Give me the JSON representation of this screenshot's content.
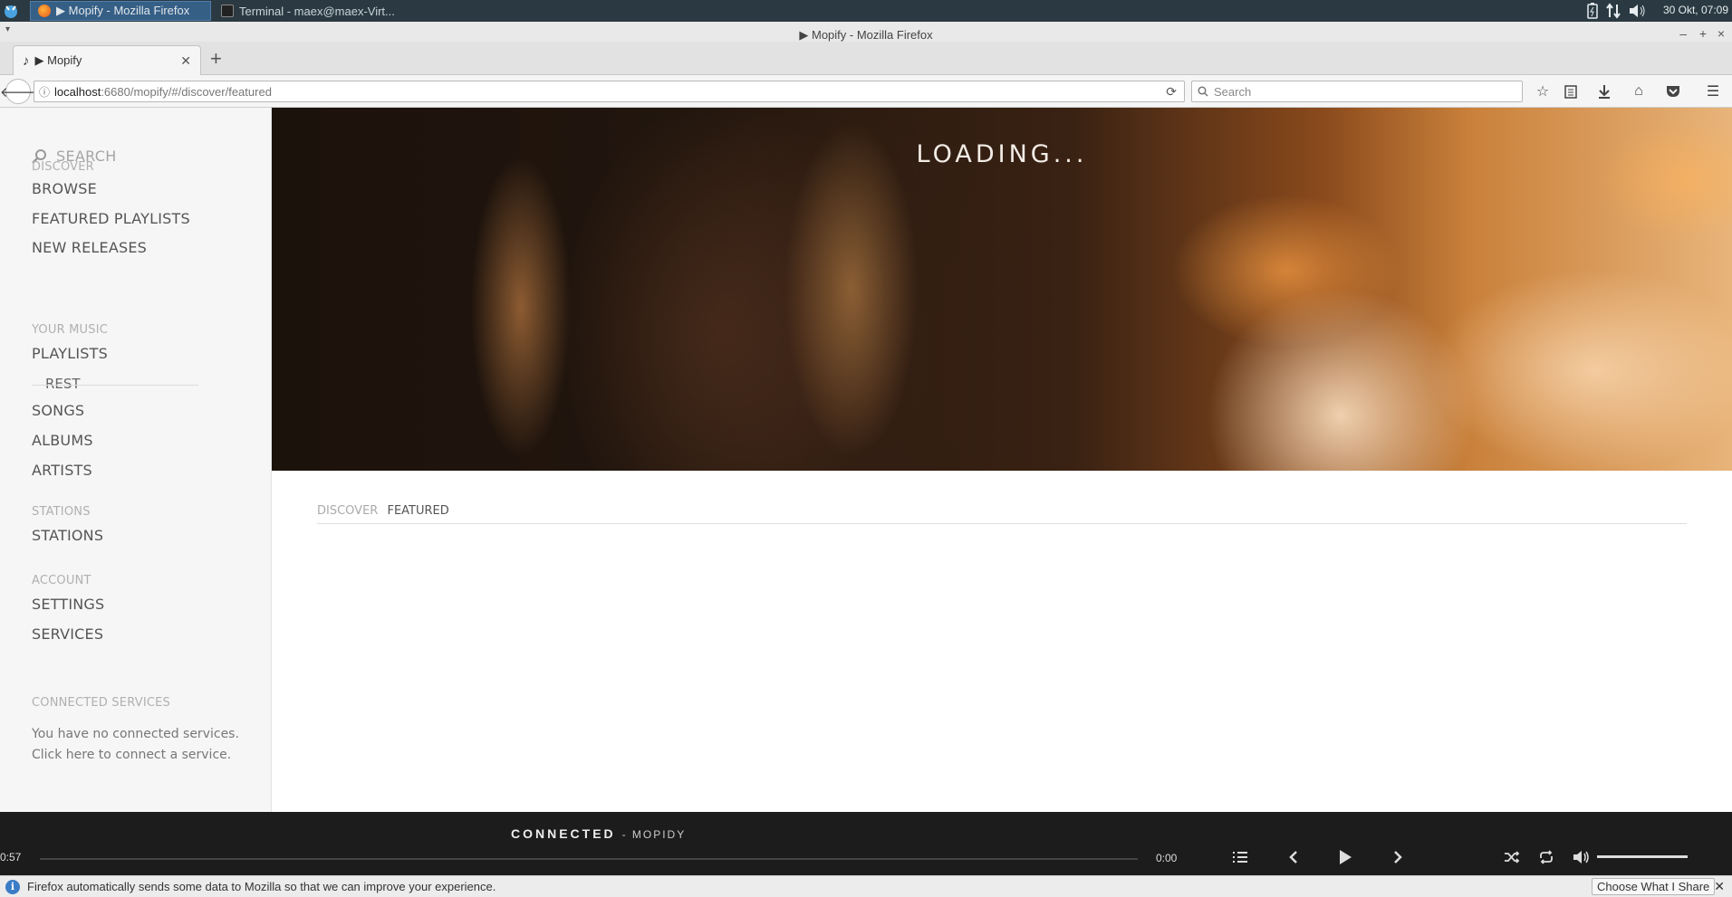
{
  "os": {
    "taskbar": [
      {
        "label": "▶ Mopify - Mozilla Firefox",
        "active": true
      },
      {
        "label": "Terminal - maex@maex-Virt...",
        "active": false
      }
    ],
    "clock": "30 Okt, 07:09"
  },
  "browser": {
    "window_title": "▶ Mopify - Mozilla Firefox",
    "tab_title": "▶ Mopify",
    "url_host": "localhost",
    "url_rest": ":6680/mopify/#/discover/featured",
    "search_placeholder": "Search"
  },
  "sidebar": {
    "search_label": "SEARCH",
    "sections": [
      {
        "title": "DISCOVER",
        "items": [
          "BROWSE",
          "FEATURED PLAYLISTS",
          "NEW RELEASES"
        ]
      },
      {
        "title": "YOUR MUSIC",
        "items": [
          "PLAYLISTS",
          "REST",
          "SONGS",
          "ALBUMS",
          "ARTISTS"
        ]
      },
      {
        "title": "STATIONS",
        "items": [
          "STATIONS"
        ]
      },
      {
        "title": "ACCOUNT",
        "items": [
          "SETTINGS",
          "SERVICES"
        ]
      },
      {
        "title": "CONNECTED SERVICES",
        "items": []
      }
    ],
    "connected_text": "You have no connected services.",
    "connect_link": "Click here to connect a service."
  },
  "main": {
    "loading": "LOADING...",
    "breadcrumb": {
      "section": "DISCOVER",
      "page": "FEATURED"
    }
  },
  "player": {
    "status_title": "CONNECTED",
    "status_artist": "- MOPIDY",
    "elapsed": "0:57",
    "total": "0:00",
    "progress": 0,
    "volume": 1.0
  },
  "notification": {
    "text": "Firefox automatically sends some data to Mozilla so that we can improve your experience.",
    "button": "Choose What I Share"
  }
}
